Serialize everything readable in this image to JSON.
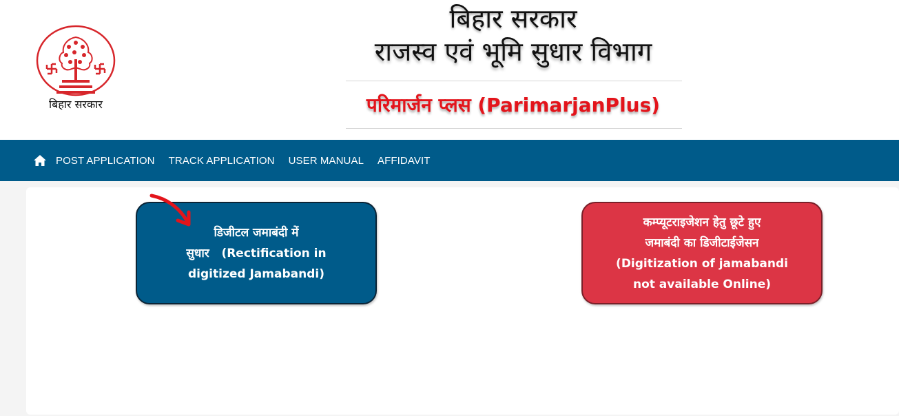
{
  "header": {
    "logo_caption": "बिहार सरकार",
    "title_line1": "बिहार सरकार",
    "title_line2": "राजस्व एवं भूमि सुधार विभाग",
    "subtitle": "परिमार्जन प्लस (ParimarjanPlus)"
  },
  "colors": {
    "brand_blue": "#005b8a",
    "accent_red": "#dc3545",
    "title_red": "#e3141b",
    "logo_red": "#d7262b"
  },
  "nav": {
    "home_icon": "home-icon",
    "items": [
      {
        "label": "POST APPLICATION"
      },
      {
        "label": "TRACK APPLICATION"
      },
      {
        "label": "USER MANUAL"
      },
      {
        "label": "AFFIDAVIT"
      }
    ]
  },
  "cards": {
    "rectification": {
      "line1": "डिजीटल जमाबंदी में",
      "line2": "सुधार   (Rectification in",
      "line3": "digitized Jamabandi)"
    },
    "digitization": {
      "line1": "कम्प्यूटराइजेशन हेतु छूटे हुए",
      "line2": "जमाबंदी का डिजीटाईजेसन",
      "line3": "(Digitization of jamabandi",
      "line4": "not available Online)"
    }
  },
  "annotation": {
    "arrow_icon": "red-arrow-icon"
  }
}
